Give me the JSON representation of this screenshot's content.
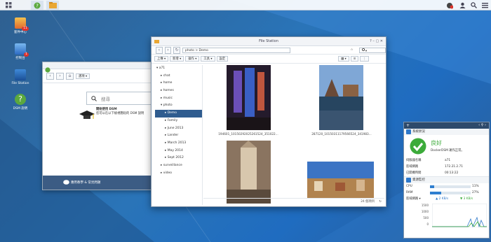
{
  "taskbar": {
    "icons": [
      "main-menu-icon",
      "help-icon",
      "file-station-icon",
      "notification-icon",
      "user-icon",
      "search-icon",
      "options-icon"
    ]
  },
  "desktop": [
    {
      "label": "套件中心",
      "badge": "11"
    },
    {
      "label": "控制台",
      "badge": "1"
    },
    {
      "label": "File Station",
      "badge": ""
    },
    {
      "label": "DSM 說明",
      "badge": ""
    }
  ],
  "help": {
    "nav_dropdown": "選項 ▾",
    "search_placeholder": "搜尋",
    "welcome_title": "開始使用 DSM",
    "welcome_text": "您可以在以下檢視簡短的 DSM 說明",
    "footer": "應用教學 & 常見問題"
  },
  "fs": {
    "title": "File Station",
    "path": "photo > Demo",
    "search": "▾",
    "toolbar": [
      "上傳 ▾",
      "新增 ▾",
      "操作 ▾",
      "工具 ▾",
      "設定"
    ],
    "tree": [
      {
        "label": "▾ a71",
        "indent": 0,
        "sel": false
      },
      {
        "label": "▸ chat",
        "indent": 1,
        "sel": false
      },
      {
        "label": "▸ home",
        "indent": 1,
        "sel": false
      },
      {
        "label": "▸ homes",
        "indent": 1,
        "sel": false
      },
      {
        "label": "▸ music",
        "indent": 1,
        "sel": false
      },
      {
        "label": "▾ photo",
        "indent": 1,
        "sel": false
      },
      {
        "label": "▸ Demo",
        "indent": 2,
        "sel": true
      },
      {
        "label": "▸ Family",
        "indent": 2,
        "sel": false
      },
      {
        "label": "▸ June 2013",
        "indent": 2,
        "sel": false
      },
      {
        "label": "▸ Lander",
        "indent": 2,
        "sel": false
      },
      {
        "label": "▸ March 2013",
        "indent": 2,
        "sel": false
      },
      {
        "label": "▸ May 2014",
        "indent": 2,
        "sel": false
      },
      {
        "label": "▸ Sept 2012",
        "indent": 2,
        "sel": false
      },
      {
        "label": "▸ surveillance",
        "indent": 1,
        "sel": false
      },
      {
        "label": "▸ video",
        "indent": 1,
        "sel": false
      }
    ],
    "captions": [
      "194601_10150292025261524_351022...",
      "287120_10150311179566524_341983..."
    ],
    "status": "24 個項目"
  },
  "widget": {
    "health_title": "系統狀況",
    "health_status": "良好",
    "health_sub": "DockerDSM 運作正常。",
    "rows": [
      {
        "k": "伺服器名稱",
        "v": "a71"
      },
      {
        "k": "區域網路",
        "v": "172.21.2.71"
      },
      {
        "k": "已開機時間",
        "v": "00:13:22"
      }
    ],
    "res_title": "資源監控",
    "cpu": {
      "label": "CPU",
      "pct": "11%",
      "value": 0.11
    },
    "ram": {
      "label": "RAM",
      "pct": "27%",
      "value": 0.27
    },
    "lan": {
      "label": "區域網路 ▾",
      "up": "2 KB/s",
      "down": "3 KB/s"
    },
    "ticks": [
      "1500",
      "1000",
      "500",
      "0"
    ]
  }
}
